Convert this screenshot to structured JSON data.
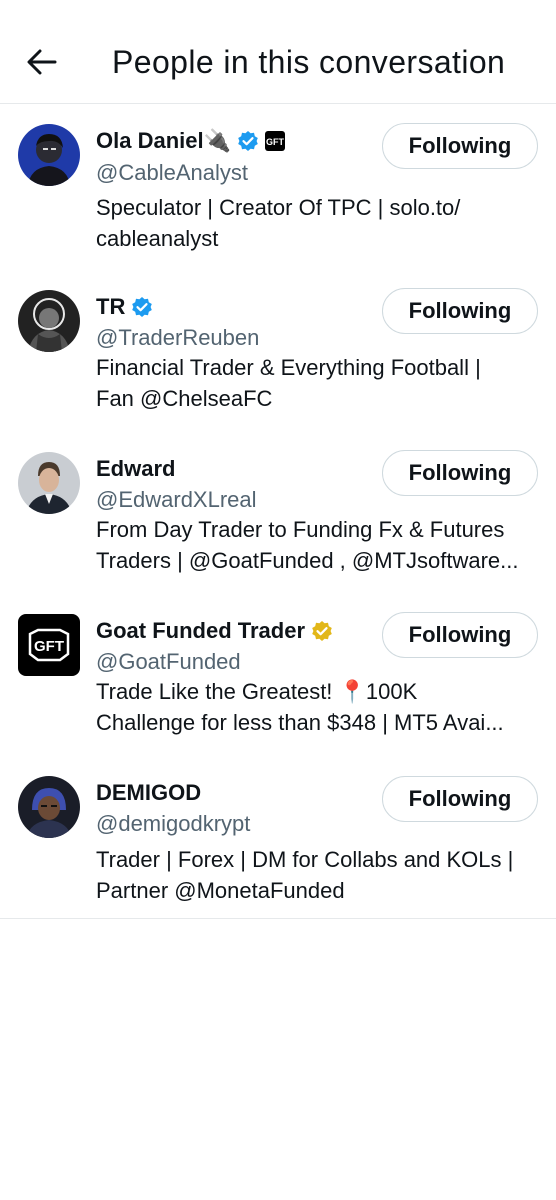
{
  "header": {
    "title": "People in this conversation",
    "back_icon": "arrow-left-icon"
  },
  "colors": {
    "verified_blue": "#1d9bf0",
    "verified_gold": "#e2b719",
    "handle_gray": "#536471",
    "text": "#0f1419",
    "divider": "#e6e9eb"
  },
  "people": [
    {
      "name": "Ola Daniel🔌",
      "handle": "@CableAnalyst",
      "bio_lines": [
        "Speculator | Creator Of TPC | solo.to/",
        "cableanalyst"
      ],
      "button": "Following",
      "badge": "blue-verified-icon",
      "affiliate": "gft-logo-icon"
    },
    {
      "name": "TR",
      "handle": "@TraderReuben",
      "bio_lines": [
        "Financial Trader & Everything Football |",
        "Fan @ChelseaFC"
      ],
      "button": "Following",
      "badge": "blue-verified-icon"
    },
    {
      "name": "Edward",
      "handle": "@EdwardXLreal",
      "bio_lines": [
        "From Day Trader to Funding Fx & Futures",
        "Traders | @GoatFunded , @MTJsoftware..."
      ],
      "button": "Following"
    },
    {
      "name": "Goat Funded Trader",
      "handle": "@GoatFunded",
      "bio_lines": [
        "Trade Like the Greatest! 📍100K",
        "Challenge for less than $348 | MT5 Avai..."
      ],
      "button": "Following",
      "badge": "gold-verified-icon"
    },
    {
      "name": "DEMIGOD",
      "handle": "@demigodkrypt",
      "bio_lines": [
        "Trader | Forex | DM for Collabs and KOLs |",
        "Partner @MonetaFunded"
      ],
      "button": "Following"
    }
  ]
}
